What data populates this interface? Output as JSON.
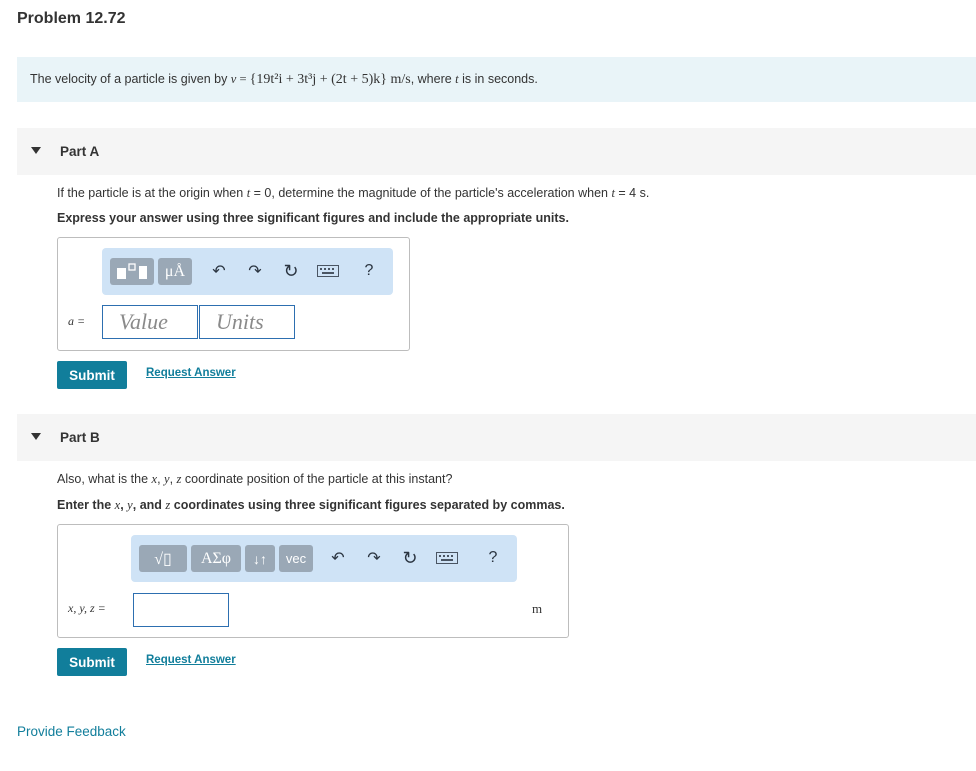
{
  "problem": {
    "title": "Problem 12.72"
  },
  "statement": {
    "prefix": "The velocity of a particle is given by ",
    "math_var": "v",
    "math_eq": " = ",
    "vector": "{19t²i + 3t³j + (2t + 5)k}",
    "units": " m/s",
    "suffix": ", where ",
    "t": "t",
    "end": " is in seconds."
  },
  "partA": {
    "label": "Part A",
    "question_1": "If the particle is at the origin when ",
    "t1": "t",
    "question_2": " = 0, determine the magnitude of the particle's acceleration when ",
    "t2": "t",
    "question_3": " = 4 s.",
    "instruction": "Express your answer using three significant figures and include the appropriate units.",
    "toolbar": {
      "units_symbol": "μÅ",
      "help": "?"
    },
    "answer_label": "a =",
    "value_placeholder": "Value",
    "units_placeholder": "Units",
    "submit_label": "Submit",
    "request_label": "Request Answer"
  },
  "partB": {
    "label": "Part B",
    "question_prefix": "Also, what is the ",
    "x": "x",
    "y": "y",
    "z": "z",
    "question_suffix": " coordinate position of the particle at this instant?",
    "instr_prefix": "Enter the ",
    "instr_mid": " and ",
    "instr_suffix": " coordinates using three significant figures separated by commas.",
    "toolbar": {
      "sqrt": "√▯",
      "greek": "ΑΣφ",
      "arrows": "↓↑",
      "vec": "vec",
      "help": "?"
    },
    "answer_label": "x, y, z =",
    "unit": "m",
    "submit_label": "Submit",
    "request_label": "Request Answer"
  },
  "footer": {
    "feedback": "Provide Feedback"
  }
}
